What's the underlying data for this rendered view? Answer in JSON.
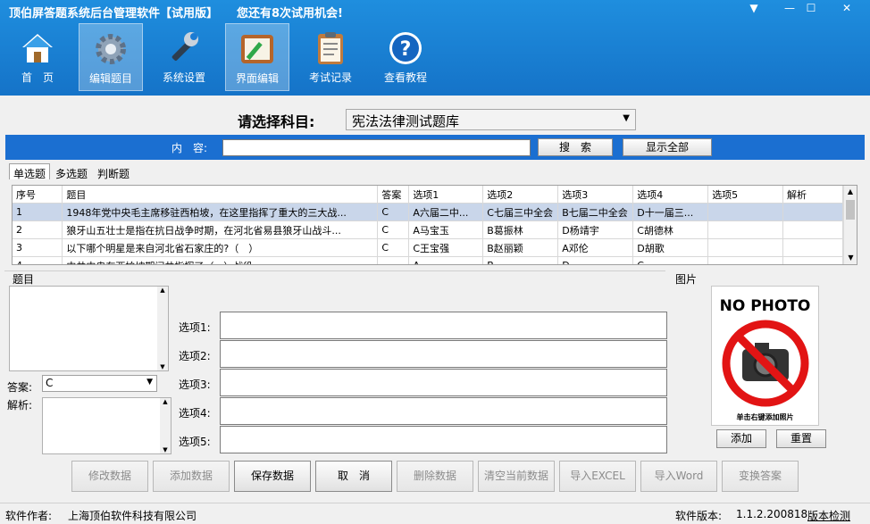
{
  "window": {
    "title": "顶伯屏答题系统后台管理软件【试用版】",
    "trial_notice": "您还有8次试用机会!"
  },
  "toolbar": {
    "items": [
      {
        "label": "首　页",
        "icon": "home-icon"
      },
      {
        "label": "编辑题目",
        "icon": "gear-icon"
      },
      {
        "label": "系统设置",
        "icon": "wrench-icon"
      },
      {
        "label": "界面编辑",
        "icon": "edit-board-icon"
      },
      {
        "label": "考试记录",
        "icon": "clipboard-icon"
      },
      {
        "label": "查看教程",
        "icon": "help-icon"
      }
    ]
  },
  "subject": {
    "label": "请选择科目:",
    "value": "宪法法律测试题库"
  },
  "search": {
    "label": "内　容:",
    "value": "",
    "search_button": "搜　索",
    "show_all_button": "显示全部"
  },
  "tabs": [
    "单选题",
    "多选题",
    "判断题"
  ],
  "table": {
    "columns": [
      "序号",
      "题目",
      "答案",
      "选项1",
      "选项2",
      "选项3",
      "选项4",
      "选项5",
      "解析"
    ],
    "rows": [
      [
        "1",
        "1948年党中央毛主席移驻西柏坡，在这里指挥了重大的三大战...",
        "C",
        "A六届二中...",
        "C七届三中全会",
        "B七届二中全会",
        "D十一届三...",
        "",
        ""
      ],
      [
        "2",
        "狼牙山五壮士是指在抗日战争时期，在河北省易县狼牙山战斗...",
        "C",
        "A马宝玉",
        "B葛振林",
        "D杨靖宇",
        "C胡德林",
        "",
        ""
      ],
      [
        "3",
        "以下哪个明星是来自河北省石家庄的?（　）",
        "C",
        "C王宝强",
        "B赵丽颖",
        "A邓伦",
        "D胡歌",
        "",
        ""
      ],
      [
        "4",
        "中共中央在西柏坡期间共指挥了（　）战役",
        "",
        "A...",
        "B...",
        "D...",
        "C...",
        "",
        ""
      ]
    ]
  },
  "editor": {
    "question_label": "题目",
    "question_value": "",
    "answer_label": "答案:",
    "answer_value": "C",
    "analysis_label": "解析:",
    "analysis_value": "",
    "options": [
      {
        "label": "选项1:",
        "value": ""
      },
      {
        "label": "选项2:",
        "value": ""
      },
      {
        "label": "选项3:",
        "value": ""
      },
      {
        "label": "选项4:",
        "value": ""
      },
      {
        "label": "选项5:",
        "value": ""
      }
    ]
  },
  "picture": {
    "label": "图片",
    "no_photo_text": "NO PHOTO",
    "hint": "单击右键添加照片",
    "add_button": "添加",
    "reset_button": "重置"
  },
  "actions": [
    "修改数据",
    "添加数据",
    "保存数据",
    "取　消",
    "删除数据",
    "清空当前数据",
    "导入EXCEL",
    "导入Word",
    "变换答案"
  ],
  "status": {
    "author_label": "软件作者:",
    "author": "上海顶伯软件科技有限公司",
    "version_label": "软件版本:",
    "version": "1.1.2.200818",
    "check_link": "版本检测"
  },
  "colors": {
    "toolbar": "#1573c8",
    "search_bar": "#1b6fd1",
    "selected_row": "#c9d6ea"
  }
}
